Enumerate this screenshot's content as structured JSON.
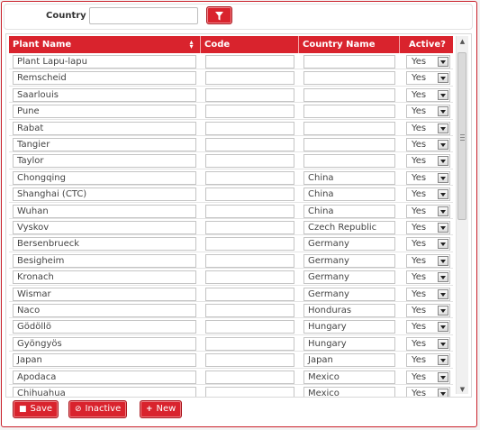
{
  "filter": {
    "label": "Country",
    "value": ""
  },
  "grid": {
    "columns": [
      "Plant Name",
      "Code",
      "Country Name",
      "Active?"
    ],
    "rows": [
      {
        "plant": "Plant Lapu-lapu",
        "code": "",
        "country": "",
        "active": "Yes"
      },
      {
        "plant": "Remscheid",
        "code": "",
        "country": "",
        "active": "Yes"
      },
      {
        "plant": "Saarlouis",
        "code": "",
        "country": "",
        "active": "Yes"
      },
      {
        "plant": "Pune",
        "code": "",
        "country": "",
        "active": "Yes"
      },
      {
        "plant": "Rabat",
        "code": "",
        "country": "",
        "active": "Yes"
      },
      {
        "plant": "Tangier",
        "code": "",
        "country": "",
        "active": "Yes"
      },
      {
        "plant": "Taylor",
        "code": "",
        "country": "",
        "active": "Yes"
      },
      {
        "plant": "Chongqing",
        "code": "",
        "country": "China",
        "active": "Yes"
      },
      {
        "plant": "Shanghai (CTC)",
        "code": "",
        "country": "China",
        "active": "Yes"
      },
      {
        "plant": "Wuhan",
        "code": "",
        "country": "China",
        "active": "Yes"
      },
      {
        "plant": "Vyskov",
        "code": "",
        "country": "Czech Republic",
        "active": "Yes"
      },
      {
        "plant": "Bersenbrueck",
        "code": "",
        "country": "Germany",
        "active": "Yes"
      },
      {
        "plant": "Besigheim",
        "code": "",
        "country": "Germany",
        "active": "Yes"
      },
      {
        "plant": "Kronach",
        "code": "",
        "country": "Germany",
        "active": "Yes"
      },
      {
        "plant": "Wismar",
        "code": "",
        "country": "Germany",
        "active": "Yes"
      },
      {
        "plant": "Naco",
        "code": "",
        "country": "Honduras",
        "active": "Yes"
      },
      {
        "plant": "Gödöllö",
        "code": "",
        "country": "Hungary",
        "active": "Yes"
      },
      {
        "plant": "Gyöngyös",
        "code": "",
        "country": "Hungary",
        "active": "Yes"
      },
      {
        "plant": "Japan",
        "code": "",
        "country": "Japan",
        "active": "Yes"
      },
      {
        "plant": "Apodaca",
        "code": "",
        "country": "Mexico",
        "active": "Yes"
      },
      {
        "plant": "Chihuahua",
        "code": "",
        "country": "Mexico",
        "active": "Yes"
      }
    ]
  },
  "actions": {
    "save": "Save",
    "inactive": "Inactive",
    "new": "New"
  },
  "icons": {
    "filter": "filter-icon",
    "sort": "sort-icon",
    "save": "floppy-icon",
    "inactive": "ban-icon",
    "new": "plus-icon"
  },
  "colors": {
    "accent": "#d9232d",
    "border": "#c9202a"
  }
}
